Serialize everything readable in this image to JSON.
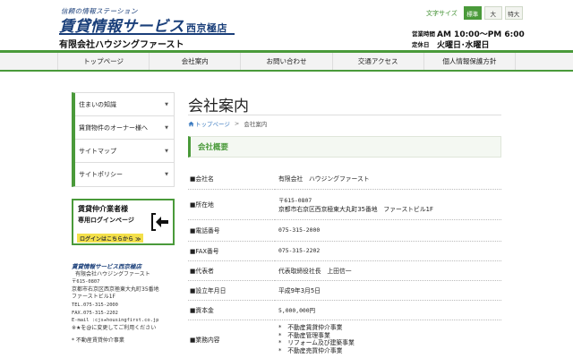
{
  "header": {
    "tagline": "信頼の情報ステーション",
    "logo_main": "賃貸情報サービス",
    "logo_sub": "西京極店",
    "company": "有限会社ハウジングファースト",
    "font_size_label": "文字サイズ",
    "font_sizes": [
      "標準",
      "大",
      "特大"
    ],
    "hours": [
      {
        "key": "営業時間",
        "value": "AM 10:00〜PM 6:00"
      },
      {
        "key": "定休日",
        "value": "火曜日･水曜日"
      }
    ]
  },
  "nav": {
    "items": [
      "トップページ",
      "会社案内",
      "お問い合わせ",
      "交通アクセス",
      "個人情報保護方針"
    ]
  },
  "sidebar": {
    "items": [
      {
        "label": "住まいの知識"
      },
      {
        "label": "賃貸物件のオーナー様へ"
      },
      {
        "label": "サイトマップ"
      },
      {
        "label": "サイトポリシー"
      }
    ],
    "banner": {
      "line1": "賃貸仲介業者様",
      "line2": "専用ログインページ",
      "button": "ログインはこちらから ≫"
    },
    "info": {
      "title": "賃貸情報サービス西京極店",
      "company": "有限会社ハウジングファースト",
      "zip": "〒615-0807",
      "address1": "京都市右京区西京極東大丸町35番地",
      "address2": "ファーストビル1F",
      "tel": "TEL.075-315-2000",
      "fax": "FAX.075-315-2202",
      "email": "E-mail :cjs★housingfirst.co.jp",
      "note": "※★を@に変更してご利用ください",
      "extra": "* 不動産賃貸仲介事業"
    }
  },
  "main": {
    "title": "会社案内",
    "breadcrumb_home": "トップページ",
    "breadcrumb_current": "会社案内",
    "section": "会社概要",
    "rows": [
      {
        "key": "■会社名",
        "value": "有限会社　ハウジングファースト"
      },
      {
        "key": "■所在地",
        "lines": [
          "〒615-0807",
          "京都市右京区西京極東大丸町35番地　ファーストビル1F"
        ]
      },
      {
        "key": "■電話番号",
        "value": "075-315-2000"
      },
      {
        "key": "■FAX番号",
        "value": "075-315-2202"
      },
      {
        "key": "■代表者",
        "value": "代表取締役社長　上田信一"
      },
      {
        "key": "■設立年月日",
        "value": "平成9年3月5日"
      },
      {
        "key": "■資本金",
        "value": "5,000,000円"
      },
      {
        "key": "■業務内容",
        "lines": [
          "*　不動産賃貸仲介事業",
          "*　不動産管理事業",
          "*　リフォーム及び建築事業",
          "*　不動産売買仲介事業"
        ]
      }
    ]
  }
}
